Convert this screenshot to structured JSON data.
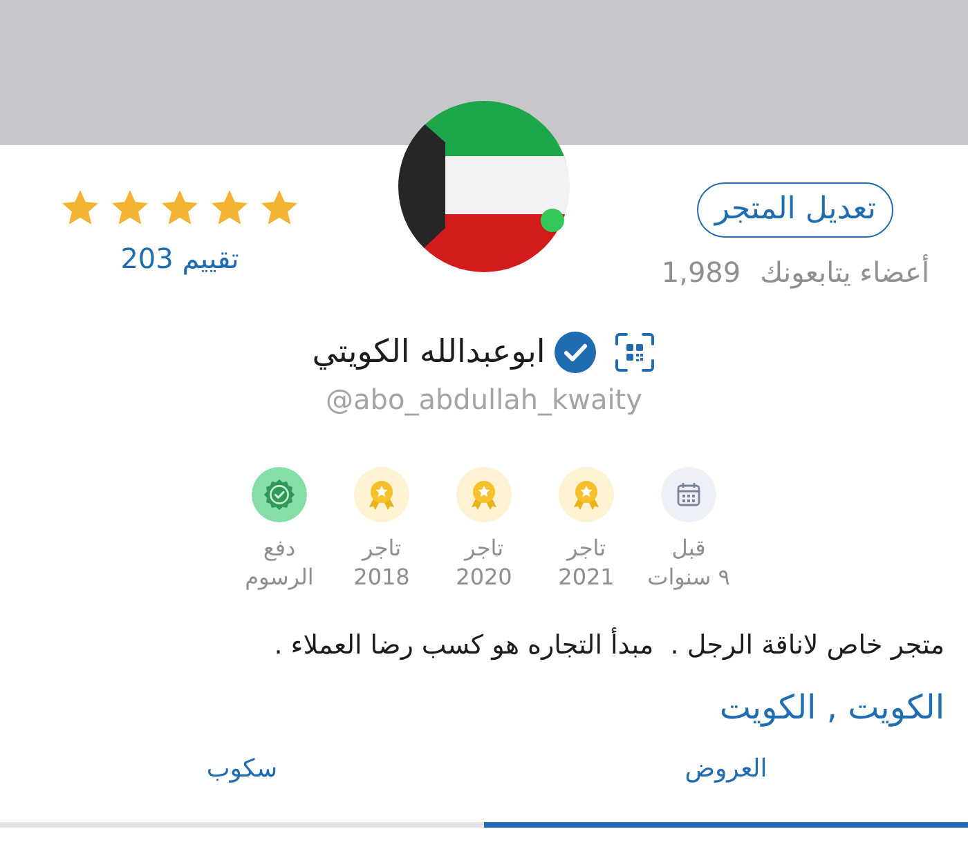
{
  "profile": {
    "online": true,
    "edit_button": "تعديل المتجر",
    "followers_label": "أعضاء يتابعونك",
    "followers_count": "1,989",
    "stars": 5,
    "rating_label": "تقييم 203",
    "verified": true,
    "name": "ابوعبدالله الكويتي",
    "handle": "@abo_abdullah_kwaity"
  },
  "badges": [
    {
      "kind": "calendar",
      "line1": "قبل",
      "line2": "٩ سنوات"
    },
    {
      "kind": "medal",
      "line1": "تاجر",
      "line2": "2021"
    },
    {
      "kind": "medal",
      "line1": "تاجر",
      "line2": "2020"
    },
    {
      "kind": "medal",
      "line1": "تاجر",
      "line2": "2018"
    },
    {
      "kind": "seal",
      "line1": "دفع",
      "line2": "الرسوم"
    }
  ],
  "description": "متجر خاص لاناقة الرجل .  مبدأ التجاره هو كسب رضا العملاء .",
  "location": "الكويت , الكويت",
  "tabs": [
    {
      "label": "العروض",
      "selected": true
    },
    {
      "label": "سكوب",
      "selected": false
    }
  ]
}
